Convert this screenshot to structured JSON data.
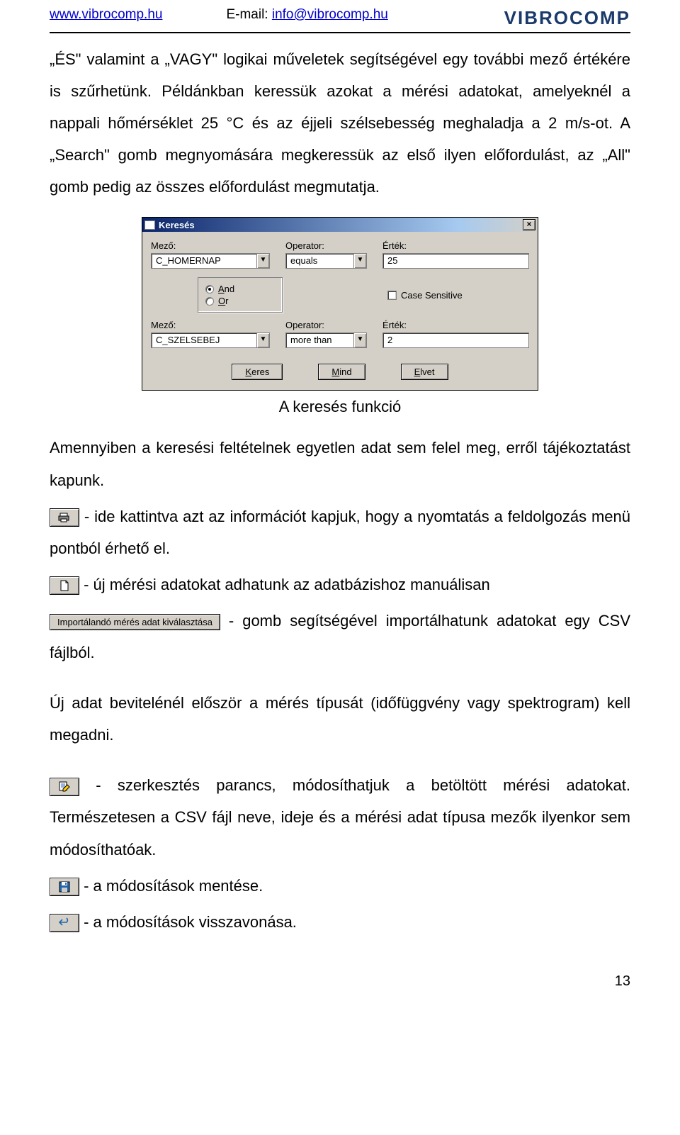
{
  "header": {
    "site": "www.vibrocomp.hu",
    "email_label": "E-mail: ",
    "email": "info@vibrocomp.hu",
    "logo": "VIBROCOMP"
  },
  "para1": "„ÉS\" valamint a „VAGY\" logikai műveletek segítségével egy további mező értékére is szűrhetünk. Példánkban keressük azokat a mérési adatokat, amelyeknél a nappali hőmérséklet 25 °C és az éjjeli szélsebesség meghaladja a 2 m/s-ot. A „Search\" gomb megnyomására megkeressük az első ilyen előfordulást, az „All\" gomb pedig az összes előfordulást megmutatja.",
  "dialog": {
    "title": "Keresés",
    "labels": {
      "mezo": "Mező:",
      "operator": "Operator:",
      "ertek": "Érték:"
    },
    "row1": {
      "mezo": "C_HOMERNAP",
      "op": "equals",
      "val": "25"
    },
    "radios": {
      "and": "And",
      "or": "Or"
    },
    "case": "Case Sensitive",
    "row2": {
      "mezo": "C_SZELSEBEJ",
      "op": "more than",
      "val": "2"
    },
    "buttons": {
      "keres": "Keres",
      "mind": "Mind",
      "elvet": "Elvet"
    }
  },
  "caption": "A keresés funkció",
  "para2": "Amennyiben a keresési feltételnek egyetlen adat sem felel meg, erről tájékoztatást kapunk.",
  "para3a": " - ide kattintva azt az információt kapjuk, hogy a nyomtatás a feldolgozás menü pontból érhető el.",
  "para4": " - új mérési adatokat adhatunk az adatbázishoz manuálisan",
  "import_btn": "Importálandó mérés adat kiválasztása",
  "para5": " - gomb segítségével importálhatunk adatokat egy CSV fájlból.",
  "para6": "Új adat bevitelénél először a mérés típusát (időfüggvény vagy  spektrogram) kell megadni.",
  "para7": " - szerkesztés parancs, módosíthatjuk a betöltött mérési adatokat. Természetesen a CSV fájl neve, ideje és a mérési adat típusa mezők ilyenkor sem módosíthatóak.",
  "para8": " - a módosítások mentése.",
  "para9": " - a módosítások visszavonása.",
  "page_no": "13"
}
